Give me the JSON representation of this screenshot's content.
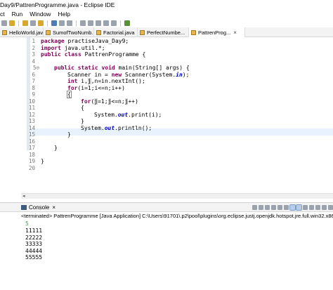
{
  "window": {
    "title": "Day9/PattrenProgramme.java - Eclipse IDE"
  },
  "menu": {
    "items": [
      "ct",
      "Run",
      "Window",
      "Help"
    ]
  },
  "tabs": [
    {
      "label": "HelloWorld.java",
      "active": false,
      "closable": false
    },
    {
      "label": "SumofTwoNumb...",
      "active": false,
      "closable": false
    },
    {
      "label": "Factorial.java",
      "active": false,
      "closable": false
    },
    {
      "label": "PerfectNumbe...",
      "active": false,
      "closable": false
    },
    {
      "label": "PattrenProg...",
      "active": true,
      "closable": true
    }
  ],
  "tab_close_glyph": "×",
  "editor": {
    "line_numbers": [
      "1",
      "2",
      "3",
      "4",
      "5⊖",
      "6",
      "7",
      "8",
      "9",
      "10",
      "11",
      "12",
      "13",
      "14",
      "15",
      "16",
      "17",
      "18",
      "19",
      "20"
    ],
    "lines": {
      "l1_kw": "package",
      "l1_rest": " practiseJava_Day9;",
      "l2_kw": "import",
      "l2_rest": " java.util.*;",
      "l3_kw1": "public",
      "l3_kw2": "class",
      "l3_rest": " PattrenProgramme {",
      "l5_kw1": "public",
      "l5_kw2": "static",
      "l5_kw3": "void",
      "l5_rest": " main(String[] args) {",
      "l6_a": "Scanner in = ",
      "l6_kw": "new",
      "l6_b": " Scanner(System.",
      "l6_fld": "in",
      "l6_c": ");",
      "l7_kw": "int",
      "l7_a": " i,",
      "l7_occ": "j",
      "l7_b": ",n=in.nextInt();",
      "l8_kw": "for",
      "l8_rest": "(i=1;i<=n;i++)",
      "l9_brace": "{",
      "l10_kw": "for",
      "l10_a": "(",
      "l10_occ1": "j",
      "l10_b": "=1;",
      "l10_occ2": "j",
      "l10_c": "<=n;",
      "l10_occ3": "j",
      "l10_d": "++)",
      "l11": "{",
      "l12_a": "System.",
      "l12_fld": "out",
      "l12_b": ".print(i);",
      "l13": "}",
      "l14_a": "System.",
      "l14_fld": "out",
      "l14_b": ".println();",
      "l15": "}",
      "l17": "}",
      "l19": "}"
    }
  },
  "scroll_left_glyph": "◂",
  "console": {
    "tab_label": "Console",
    "close_glyph": "×",
    "terminated_text": "<terminated> PattrenProgramme [Java Application] C:\\Users\\91701\\.p2\\pool\\plugins\\org.eclipse.justj.openjdk.hotspot.jre.full.win32.x86_64_",
    "input_value": "5",
    "output_lines": [
      "11111",
      "22222",
      "33333",
      "44444",
      "55555"
    ]
  }
}
